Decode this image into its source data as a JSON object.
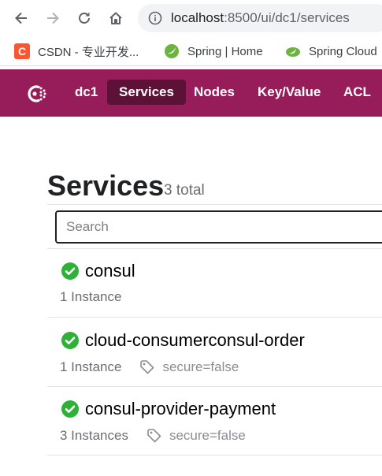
{
  "browser": {
    "url_host": "localhost",
    "url_path": ":8500/ui/dc1/services"
  },
  "bookmarks": [
    {
      "icon": "csdn-icon",
      "label": "CSDN - 专业开发..."
    },
    {
      "icon": "spring-icon",
      "label": "Spring | Home"
    },
    {
      "icon": "spring-icon",
      "label": "Spring Cloud"
    }
  ],
  "navbar": {
    "datacenter": "dc1",
    "items": [
      {
        "label": "Services",
        "active": true
      },
      {
        "label": "Nodes",
        "active": false
      },
      {
        "label": "Key/Value",
        "active": false
      },
      {
        "label": "ACL",
        "active": false
      }
    ],
    "color": "#961d59",
    "active_color": "#5c1137"
  },
  "page": {
    "title": "Services",
    "total": "3 total"
  },
  "search": {
    "placeholder": "Search"
  },
  "services": [
    {
      "name": "consul",
      "instances": "1 Instance",
      "tag": ""
    },
    {
      "name": "cloud-consumerconsul-order",
      "instances": "1 Instance",
      "tag": "secure=false"
    },
    {
      "name": "consul-provider-payment",
      "instances": "3 Instances",
      "tag": "secure=false"
    }
  ],
  "status_color": "#2eb039"
}
